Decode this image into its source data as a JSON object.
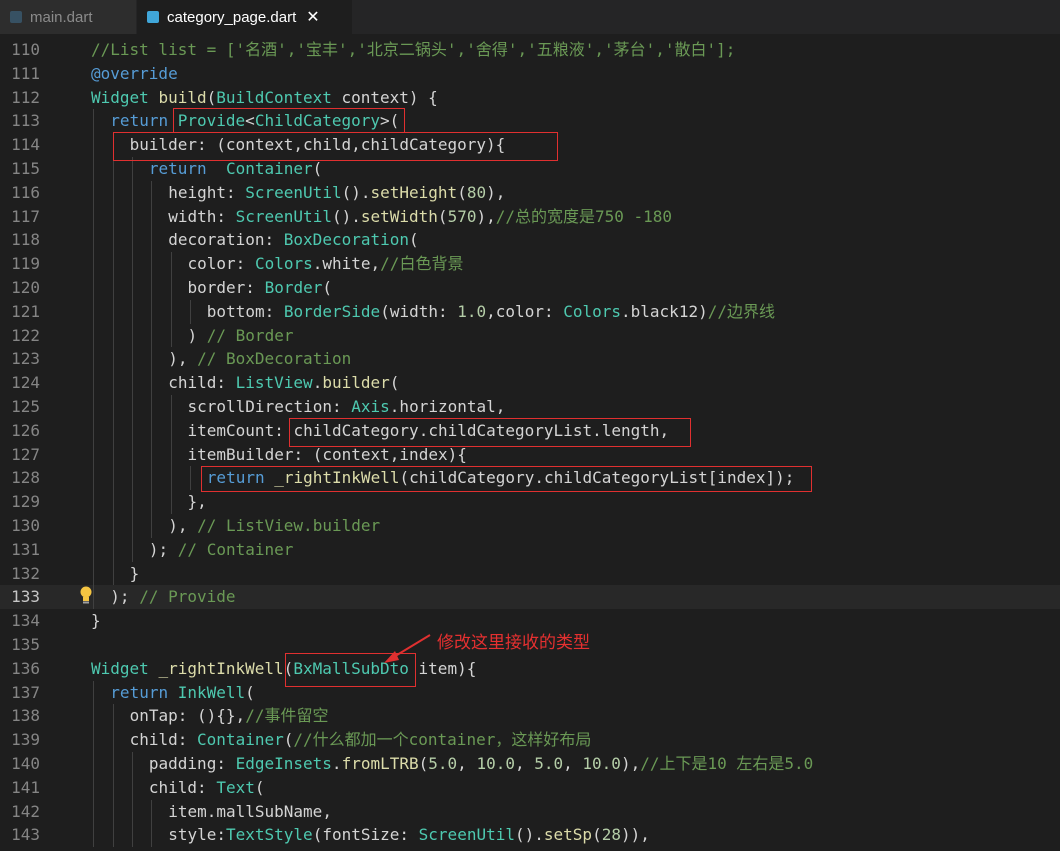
{
  "tabs": [
    {
      "label": "main.dart"
    },
    {
      "label": "category_page.dart",
      "close": "✕"
    }
  ],
  "annotation": "修改这里接收的类型",
  "lines": [
    {
      "num": "110",
      "indent": 0,
      "tokens": [
        [
          "c",
          "//List list = ['名酒','宝丰','北京二锅头','舍得','五粮液','茅台','散白'];"
        ]
      ]
    },
    {
      "num": "111",
      "indent": 0,
      "tokens": [
        [
          "k",
          "@override"
        ]
      ]
    },
    {
      "num": "112",
      "indent": 0,
      "tokens": [
        [
          "t",
          "Widget"
        ],
        [
          "",
          " "
        ],
        [
          "f",
          "build"
        ],
        [
          "",
          "("
        ],
        [
          "t",
          "BuildContext"
        ],
        [
          "",
          " context) {"
        ]
      ]
    },
    {
      "num": "113",
      "indent": 1,
      "tokens": [
        [
          "k",
          "return"
        ],
        [
          "",
          " "
        ],
        [
          "t",
          "Provide"
        ],
        [
          "",
          "<"
        ],
        [
          "t",
          "ChildCategory"
        ],
        [
          "",
          ">("
        ]
      ]
    },
    {
      "num": "114",
      "indent": 2,
      "tokens": [
        [
          "",
          "builder: (context,child,childCategory){"
        ]
      ]
    },
    {
      "num": "115",
      "indent": 3,
      "tokens": [
        [
          "k",
          "return"
        ],
        [
          "",
          "  "
        ],
        [
          "t",
          "Container"
        ],
        [
          "",
          "("
        ]
      ]
    },
    {
      "num": "116",
      "indent": 4,
      "tokens": [
        [
          "",
          "height: "
        ],
        [
          "t",
          "ScreenUtil"
        ],
        [
          "",
          "()."
        ],
        [
          "f",
          "setHeight"
        ],
        [
          "",
          "("
        ],
        [
          "n",
          "80"
        ],
        [
          "",
          "),"
        ]
      ]
    },
    {
      "num": "117",
      "indent": 4,
      "tokens": [
        [
          "",
          "width: "
        ],
        [
          "t",
          "ScreenUtil"
        ],
        [
          "",
          "()."
        ],
        [
          "f",
          "setWidth"
        ],
        [
          "",
          "("
        ],
        [
          "n",
          "570"
        ],
        [
          "",
          "),"
        ],
        [
          "c",
          "//总的宽度是750 -180"
        ]
      ]
    },
    {
      "num": "118",
      "indent": 4,
      "tokens": [
        [
          "",
          "decoration: "
        ],
        [
          "t",
          "BoxDecoration"
        ],
        [
          "",
          "("
        ]
      ]
    },
    {
      "num": "119",
      "indent": 5,
      "tokens": [
        [
          "",
          "color: "
        ],
        [
          "t",
          "Colors"
        ],
        [
          "",
          ".white,"
        ],
        [
          "c",
          "//白色背景"
        ]
      ]
    },
    {
      "num": "120",
      "indent": 5,
      "tokens": [
        [
          "",
          "border: "
        ],
        [
          "t",
          "Border"
        ],
        [
          "",
          "("
        ]
      ]
    },
    {
      "num": "121",
      "indent": 6,
      "tokens": [
        [
          "",
          "bottom: "
        ],
        [
          "t",
          "BorderSide"
        ],
        [
          "",
          "(width: "
        ],
        [
          "n",
          "1.0"
        ],
        [
          "",
          ",color: "
        ],
        [
          "t",
          "Colors"
        ],
        [
          "",
          ".black12)"
        ],
        [
          "c",
          "//边界线"
        ]
      ]
    },
    {
      "num": "122",
      "indent": 5,
      "tokens": [
        [
          "",
          ") "
        ],
        [
          "c",
          "// Border"
        ]
      ]
    },
    {
      "num": "123",
      "indent": 4,
      "tokens": [
        [
          "",
          "), "
        ],
        [
          "c",
          "// BoxDecoration"
        ]
      ]
    },
    {
      "num": "124",
      "indent": 4,
      "tokens": [
        [
          "",
          "child: "
        ],
        [
          "t",
          "ListView"
        ],
        [
          "",
          "."
        ],
        [
          "f",
          "builder"
        ],
        [
          "",
          "("
        ]
      ]
    },
    {
      "num": "125",
      "indent": 5,
      "tokens": [
        [
          "",
          "scrollDirection: "
        ],
        [
          "t",
          "Axis"
        ],
        [
          "",
          ".horizontal,"
        ]
      ]
    },
    {
      "num": "126",
      "indent": 5,
      "tokens": [
        [
          "",
          "itemCount: childCategory.childCategoryList.length,"
        ]
      ]
    },
    {
      "num": "127",
      "indent": 5,
      "tokens": [
        [
          "",
          "itemBuilder: (context,index){"
        ]
      ]
    },
    {
      "num": "128",
      "indent": 6,
      "tokens": [
        [
          "k",
          "return"
        ],
        [
          "",
          " "
        ],
        [
          "f",
          "_rightInkWell"
        ],
        [
          "",
          "(childCategory.childCategoryList[index]);"
        ]
      ]
    },
    {
      "num": "129",
      "indent": 5,
      "tokens": [
        [
          "",
          "},"
        ]
      ]
    },
    {
      "num": "130",
      "indent": 4,
      "tokens": [
        [
          "",
          "), "
        ],
        [
          "c",
          "// ListView.builder"
        ]
      ]
    },
    {
      "num": "131",
      "indent": 3,
      "tokens": [
        [
          "",
          "); "
        ],
        [
          "c",
          "// Container"
        ]
      ]
    },
    {
      "num": "132",
      "indent": 2,
      "tokens": [
        [
          "",
          "}"
        ]
      ]
    },
    {
      "num": "133",
      "indent": 1,
      "tokens": [
        [
          "",
          "); "
        ],
        [
          "c",
          "// Provide"
        ]
      ]
    },
    {
      "num": "134",
      "indent": 0,
      "tokens": [
        [
          "",
          "}"
        ]
      ]
    },
    {
      "num": "135",
      "indent": 0,
      "tokens": []
    },
    {
      "num": "136",
      "indent": 0,
      "tokens": [
        [
          "t",
          "Widget"
        ],
        [
          "",
          " "
        ],
        [
          "f",
          "_rightInkWell"
        ],
        [
          "",
          "("
        ],
        [
          "t",
          "BxMallSubDto"
        ],
        [
          "",
          " item){"
        ]
      ]
    },
    {
      "num": "137",
      "indent": 1,
      "tokens": [
        [
          "k",
          "return"
        ],
        [
          "",
          " "
        ],
        [
          "t",
          "InkWell"
        ],
        [
          "",
          "("
        ]
      ]
    },
    {
      "num": "138",
      "indent": 2,
      "tokens": [
        [
          "",
          "onTap: (){},"
        ],
        [
          "c",
          "//事件留空"
        ]
      ]
    },
    {
      "num": "139",
      "indent": 2,
      "tokens": [
        [
          "",
          "child: "
        ],
        [
          "t",
          "Container"
        ],
        [
          "",
          "("
        ],
        [
          "c",
          "//什么都加一个container，这样好布局"
        ]
      ]
    },
    {
      "num": "140",
      "indent": 3,
      "tokens": [
        [
          "",
          "padding: "
        ],
        [
          "t",
          "EdgeInsets"
        ],
        [
          "",
          "."
        ],
        [
          "f",
          "fromLTRB"
        ],
        [
          "",
          "("
        ],
        [
          "n",
          "5.0"
        ],
        [
          "",
          ", "
        ],
        [
          "n",
          "10.0"
        ],
        [
          "",
          ", "
        ],
        [
          "n",
          "5.0"
        ],
        [
          "",
          ", "
        ],
        [
          "n",
          "10.0"
        ],
        [
          "",
          "),"
        ],
        [
          "c",
          "//上下是10 左右是5.0"
        ]
      ]
    },
    {
      "num": "141",
      "indent": 3,
      "tokens": [
        [
          "",
          "child: "
        ],
        [
          "t",
          "Text"
        ],
        [
          "",
          "("
        ]
      ]
    },
    {
      "num": "142",
      "indent": 4,
      "tokens": [
        [
          "",
          "item.mallSubName,"
        ]
      ]
    },
    {
      "num": "143",
      "indent": 4,
      "tokens": [
        [
          "",
          "style:"
        ],
        [
          "t",
          "TextStyle"
        ],
        [
          "",
          "(fontSize: "
        ],
        [
          "t",
          "ScreenUtil"
        ],
        [
          "",
          "()."
        ],
        [
          "f",
          "setSp"
        ],
        [
          "",
          "("
        ],
        [
          "n",
          "28"
        ],
        [
          "",
          ")),"
        ]
      ]
    }
  ]
}
